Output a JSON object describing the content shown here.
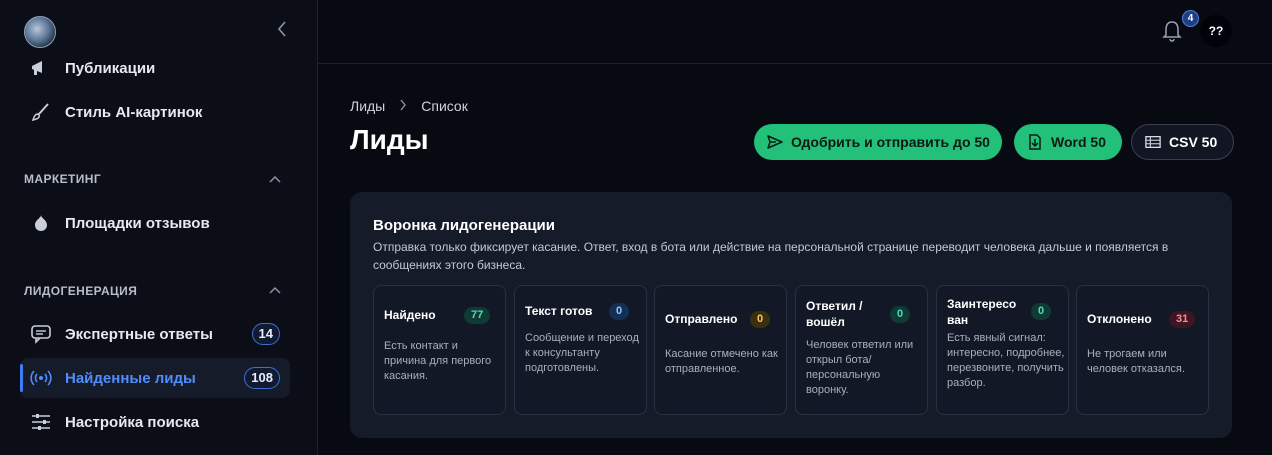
{
  "sidebar": {
    "items": [
      {
        "label": "Публикации",
        "icon": "megaphone-icon"
      },
      {
        "label": "Стиль AI-картинок",
        "icon": "brush-icon"
      },
      {
        "label": "Площадки отзывов",
        "icon": "garlic-icon"
      },
      {
        "label": "Экспертные ответы",
        "icon": "chat-bubble-icon",
        "count": "14"
      },
      {
        "label": "Найденные лиды",
        "icon": "radio-waves-icon",
        "count": "108"
      },
      {
        "label": "Настройка поиска",
        "icon": "sliders-icon"
      }
    ],
    "sections": [
      {
        "title": "МАРКЕТИНГ"
      },
      {
        "title": "ЛИДОГЕНЕРАЦИЯ"
      }
    ]
  },
  "topbar": {
    "notifications": "4",
    "avatar": "??"
  },
  "breadcrumb": [
    "Лиды",
    "Список"
  ],
  "page_title": "Лиды",
  "actions": {
    "approve_send": "Одобрить и отправить до 50",
    "word": "Word 50",
    "csv": "CSV 50"
  },
  "funnel": {
    "title": "Воронка лидогенерации",
    "description": "Отправка только фиксирует касание. Ответ, вход в бота или действие на персональной странице переводит человека дальше и появляется в сообщениях этого бизнеса.",
    "stages": [
      {
        "title": "Найдено",
        "count": "77",
        "desc": "Есть контакт и причина для первого касания."
      },
      {
        "title": "Текст готов",
        "count": "0",
        "desc": "Сообщение и переход к консультанту подготовлены."
      },
      {
        "title": "Отправлено",
        "count": "0",
        "desc": "Касание отмечено как отправленное."
      },
      {
        "title": "Ответил / вошёл",
        "count": "0",
        "desc": "Человек ответил или открыл бота/ персональную воронку."
      },
      {
        "title": "Заинтересо ван",
        "count": "0",
        "desc": "Есть явный сигнал: интересно, подробнее, перезвоните, получить разбор."
      },
      {
        "title": "Отклонено",
        "count": "31",
        "desc": "Не трогаем или человек отказался."
      }
    ]
  }
}
